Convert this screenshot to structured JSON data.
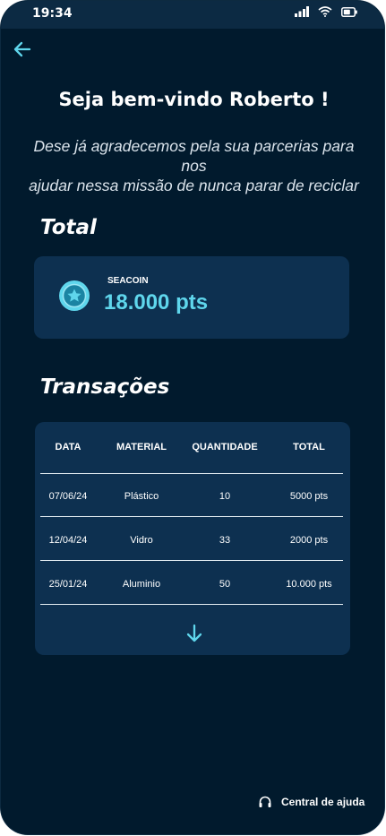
{
  "status_bar": {
    "time": "19:34"
  },
  "header": {
    "back_icon": "arrow-left-icon",
    "title": "Seja bem-vindo Roberto !",
    "subtitle_line1": "Dese já agradecemos pela sua parcerias para nos",
    "subtitle_line2": "ajudar nessa missão de nunca parar de reciclar"
  },
  "total": {
    "section_title": "Total",
    "coin_icon": "star-coin-icon",
    "label": "SEACOIN",
    "value": "18.000 pts"
  },
  "transactions": {
    "section_title": "Transações",
    "columns": [
      "DATA",
      "MATERIAL",
      "QUANTIDADE",
      "TOTAL"
    ],
    "rows": [
      {
        "date": "07/06/24",
        "material": "Plástico",
        "quantity": "10",
        "total": "5000 pts"
      },
      {
        "date": "12/04/24",
        "material": "Vidro",
        "quantity": "33",
        "total": "2000 pts"
      },
      {
        "date": "25/01/24",
        "material": "Aluminio",
        "quantity": "50",
        "total": "10.000 pts"
      }
    ],
    "more_icon": "arrow-down-icon"
  },
  "footer": {
    "help_icon": "headset-icon",
    "help_label": "Central de ajuda"
  },
  "colors": {
    "background": "#011a2d",
    "card": "#0d3050",
    "accent": "#5fd6ec"
  }
}
